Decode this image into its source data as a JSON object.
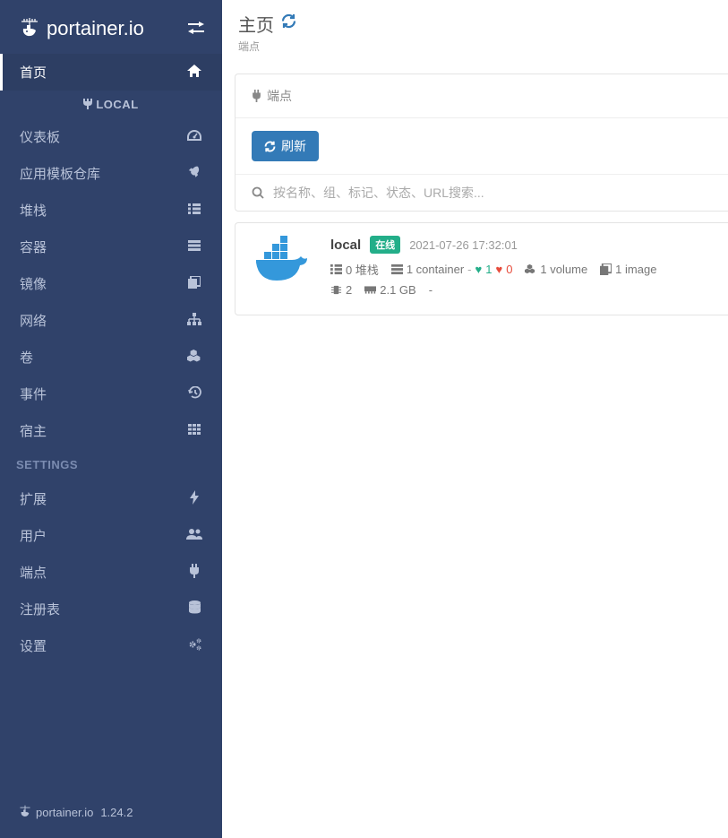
{
  "brand": "portainer.io",
  "version": "1.24.2",
  "page": {
    "title": "主页",
    "subtitle": "端点"
  },
  "sidebar": {
    "home": "首页",
    "localSection": "LOCAL",
    "items": [
      {
        "label": "仪表板",
        "name": "dashboard"
      },
      {
        "label": "应用模板仓库",
        "name": "app-templates"
      },
      {
        "label": "堆栈",
        "name": "stacks"
      },
      {
        "label": "容器",
        "name": "containers"
      },
      {
        "label": "镜像",
        "name": "images"
      },
      {
        "label": "网络",
        "name": "networks"
      },
      {
        "label": "卷",
        "name": "volumes"
      },
      {
        "label": "事件",
        "name": "events"
      },
      {
        "label": "宿主",
        "name": "host"
      }
    ],
    "settingsHeader": "SETTINGS",
    "settings": [
      {
        "label": "扩展",
        "name": "extensions"
      },
      {
        "label": "用户",
        "name": "users"
      },
      {
        "label": "端点",
        "name": "endpoints"
      },
      {
        "label": "注册表",
        "name": "registries"
      },
      {
        "label": "设置",
        "name": "settings"
      }
    ]
  },
  "panel": {
    "title": "端点",
    "refreshBtn": "刷新",
    "searchPlaceholder": "按名称、组、标记、状态、URL搜索..."
  },
  "endpoint": {
    "name": "local",
    "status": "在线",
    "timestamp": "2021-07-26 17:32:01",
    "stacks": "0 堆栈",
    "containers": "1 container",
    "healthy": "1",
    "unhealthy": "0",
    "volumes": "1 volume",
    "images": "1 image",
    "cpus": "2",
    "memory": "2.1 GB",
    "extra": "-"
  }
}
